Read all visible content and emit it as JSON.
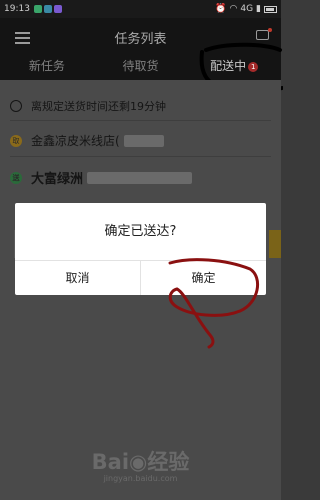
{
  "status_bar": {
    "time": "19:13",
    "network": "4G"
  },
  "header": {
    "title": "任务列表",
    "tabs": [
      {
        "label": "新任务"
      },
      {
        "label": "待取货"
      },
      {
        "label": "配送中",
        "badge": "1"
      }
    ]
  },
  "task": {
    "deadline_text": "离规定送货时间还剩19分钟",
    "pickup_icon": "取",
    "pickup_name": "金鑫凉皮米线店(",
    "delivery_icon": "送",
    "delivery_name": "大富绿洲"
  },
  "dialog": {
    "title": "确定已送达?",
    "cancel_label": "取消",
    "confirm_label": "确定"
  },
  "watermark": {
    "logo": "Bai◉经验",
    "url": "jingyan.baidu.com"
  }
}
